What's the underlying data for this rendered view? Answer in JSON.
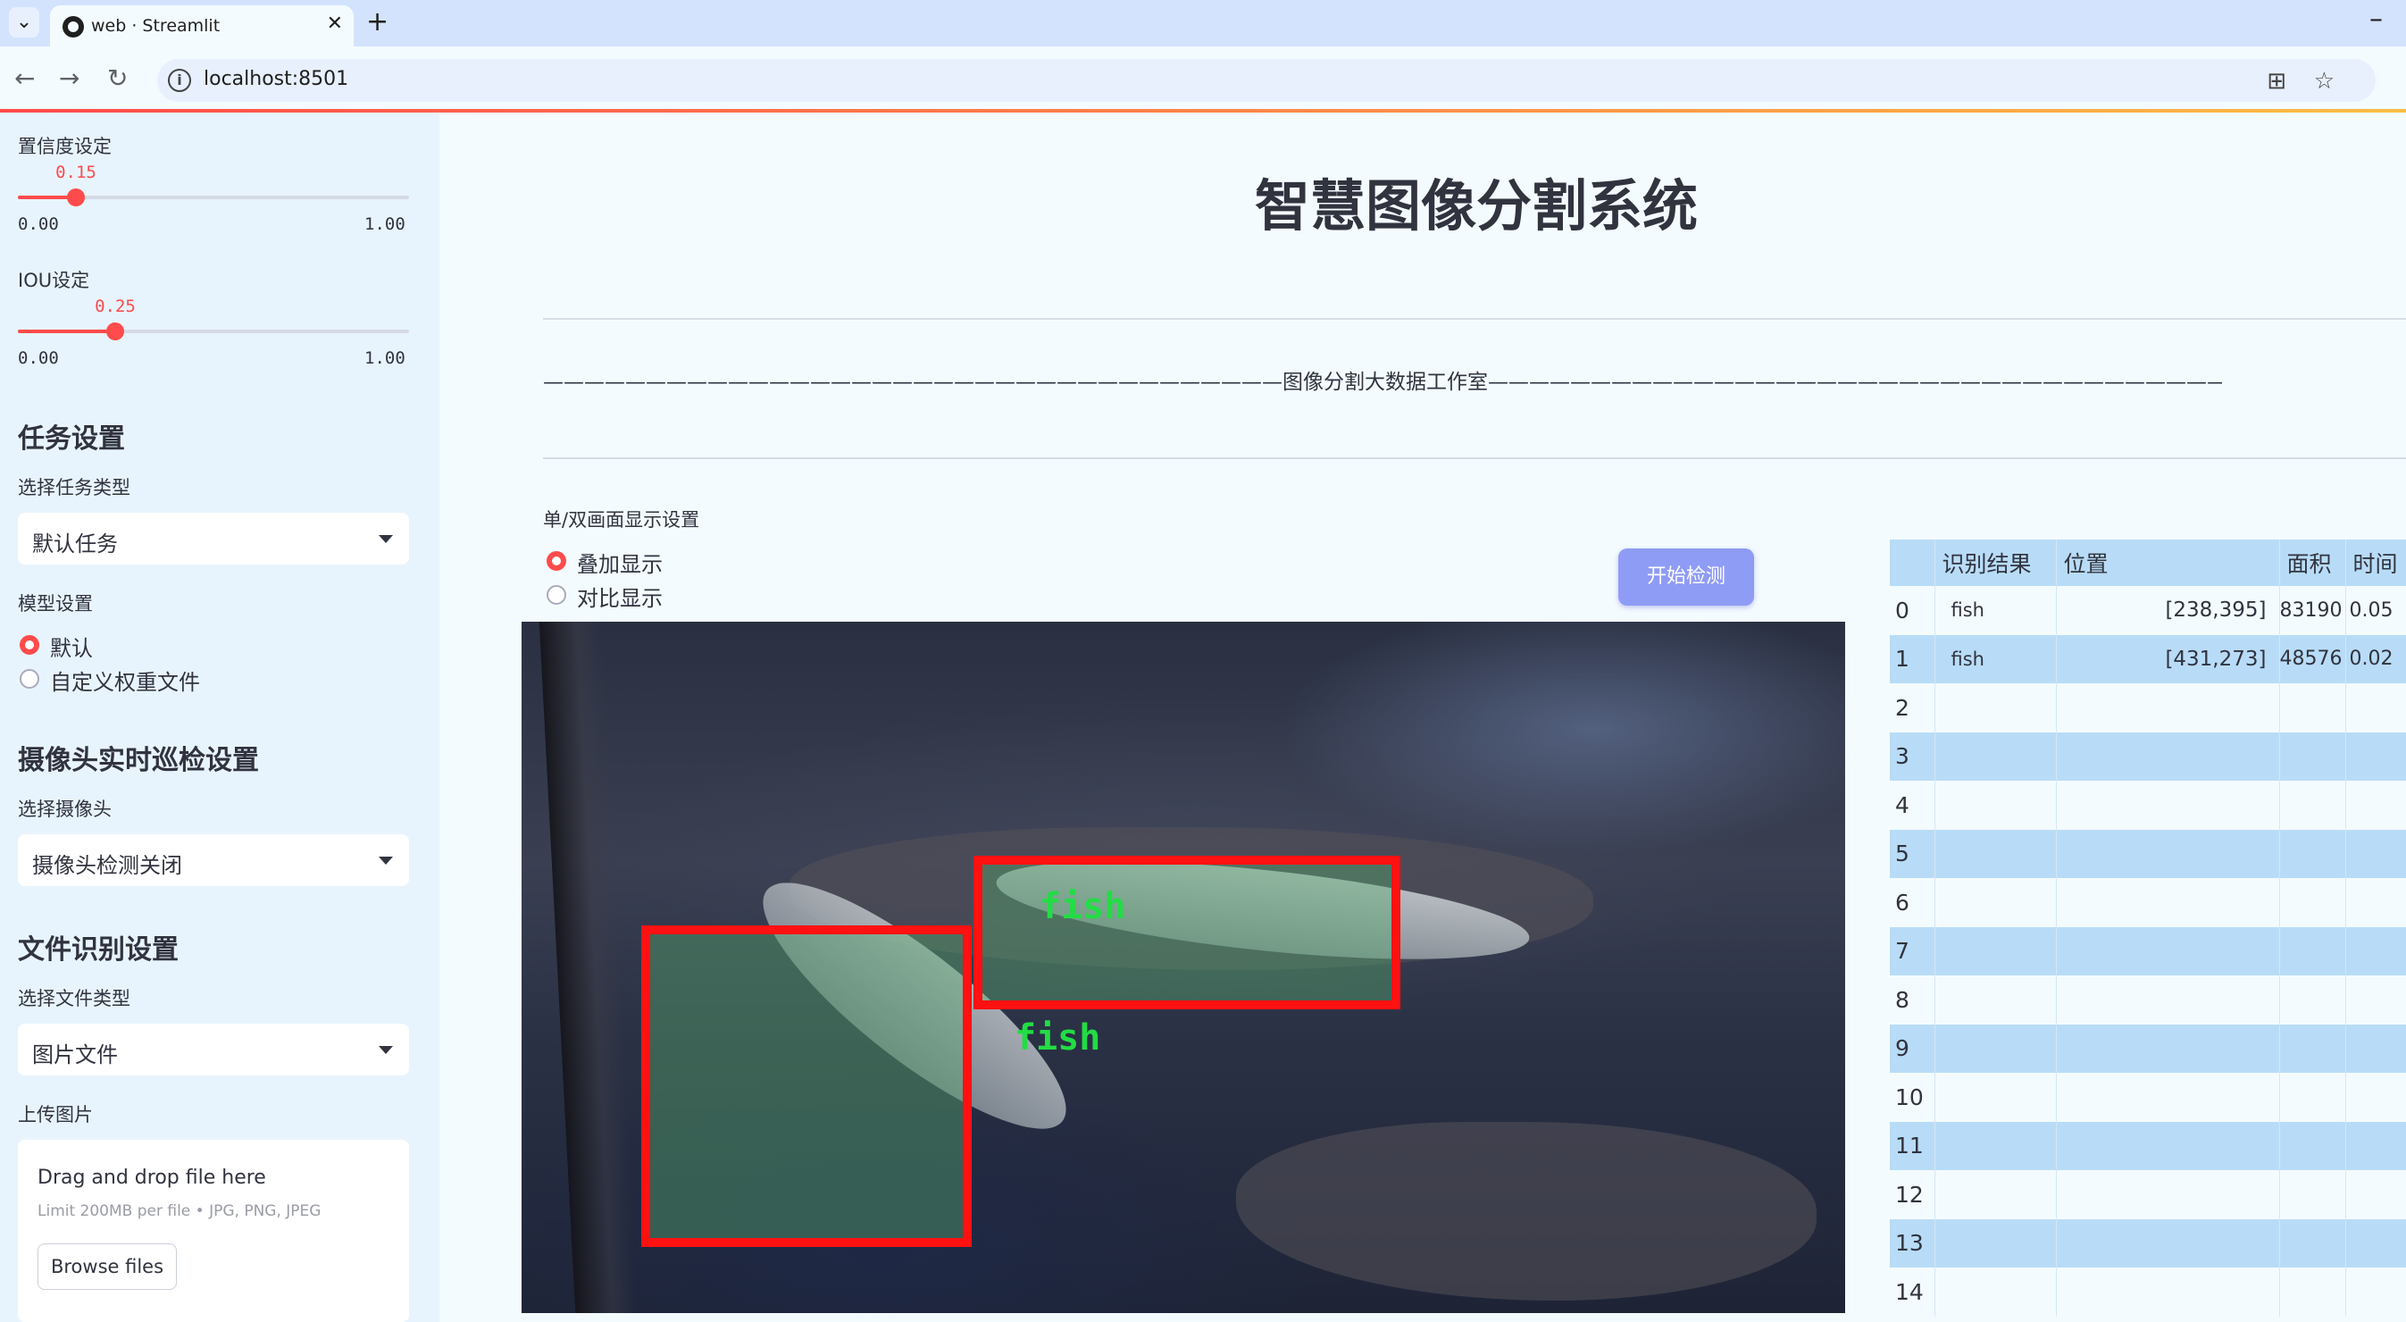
{
  "browser": {
    "tab_title": "web · Streamlit",
    "url": "localhost:8501"
  },
  "sidebar": {
    "confidence": {
      "label": "置信度设定",
      "value": 0.15,
      "value_label": "0.15",
      "min": "0.00",
      "max": "1.00"
    },
    "iou": {
      "label": "IOU设定",
      "value": 0.25,
      "value_label": "0.25",
      "min": "0.00",
      "max": "1.00"
    },
    "task_heading": "任务设置",
    "task_type_label": "选择任务类型",
    "task_type_value": "默认任务",
    "model_label": "模型设置",
    "model_options": [
      "默认",
      "自定义权重文件"
    ],
    "camera_heading": "摄像头实时巡检设置",
    "camera_label": "选择摄像头",
    "camera_value": "摄像头检测关闭",
    "file_heading": "文件识别设置",
    "file_type_label": "选择文件类型",
    "file_type_value": "图片文件",
    "upload_label": "上传图片",
    "upload_title": "Drag and drop file here",
    "upload_sub": "Limit 200MB per file • JPG, PNG, JPEG",
    "browse_label": "Browse files"
  },
  "main": {
    "title": "智慧图像分割系统",
    "studio_line": "————————————————————————————————————图像分割大数据工作室————————————————————————————————————",
    "display_label": "单/双画面显示设置",
    "display_options": [
      "叠加显示",
      "对比显示"
    ],
    "start_button": "开始检测"
  },
  "detections": [
    {
      "label": "fish"
    },
    {
      "label": "fish"
    }
  ],
  "table": {
    "headers": [
      "",
      "识别结果",
      "位置",
      "面积",
      "时间"
    ],
    "rows": [
      [
        "0",
        "fish",
        "[238,395]",
        "83190",
        "0.05"
      ],
      [
        "1",
        "fish",
        "[431,273]",
        "48576",
        "0.02"
      ],
      [
        "2",
        "",
        "",
        "",
        ""
      ],
      [
        "3",
        "",
        "",
        "",
        ""
      ],
      [
        "4",
        "",
        "",
        "",
        ""
      ],
      [
        "5",
        "",
        "",
        "",
        ""
      ],
      [
        "6",
        "",
        "",
        "",
        ""
      ],
      [
        "7",
        "",
        "",
        "",
        ""
      ],
      [
        "8",
        "",
        "",
        "",
        ""
      ],
      [
        "9",
        "",
        "",
        "",
        ""
      ],
      [
        "10",
        "",
        "",
        "",
        ""
      ],
      [
        "11",
        "",
        "",
        "",
        ""
      ],
      [
        "12",
        "",
        "",
        "",
        ""
      ],
      [
        "13",
        "",
        "",
        "",
        ""
      ],
      [
        "14",
        "",
        "",
        "",
        ""
      ]
    ]
  },
  "colors": {
    "accent": "#ff4b4b",
    "button": "#8f9cf5",
    "table_stripe": "#b8dcf7",
    "box": "#ff1111",
    "box_label": "#22dd44"
  }
}
